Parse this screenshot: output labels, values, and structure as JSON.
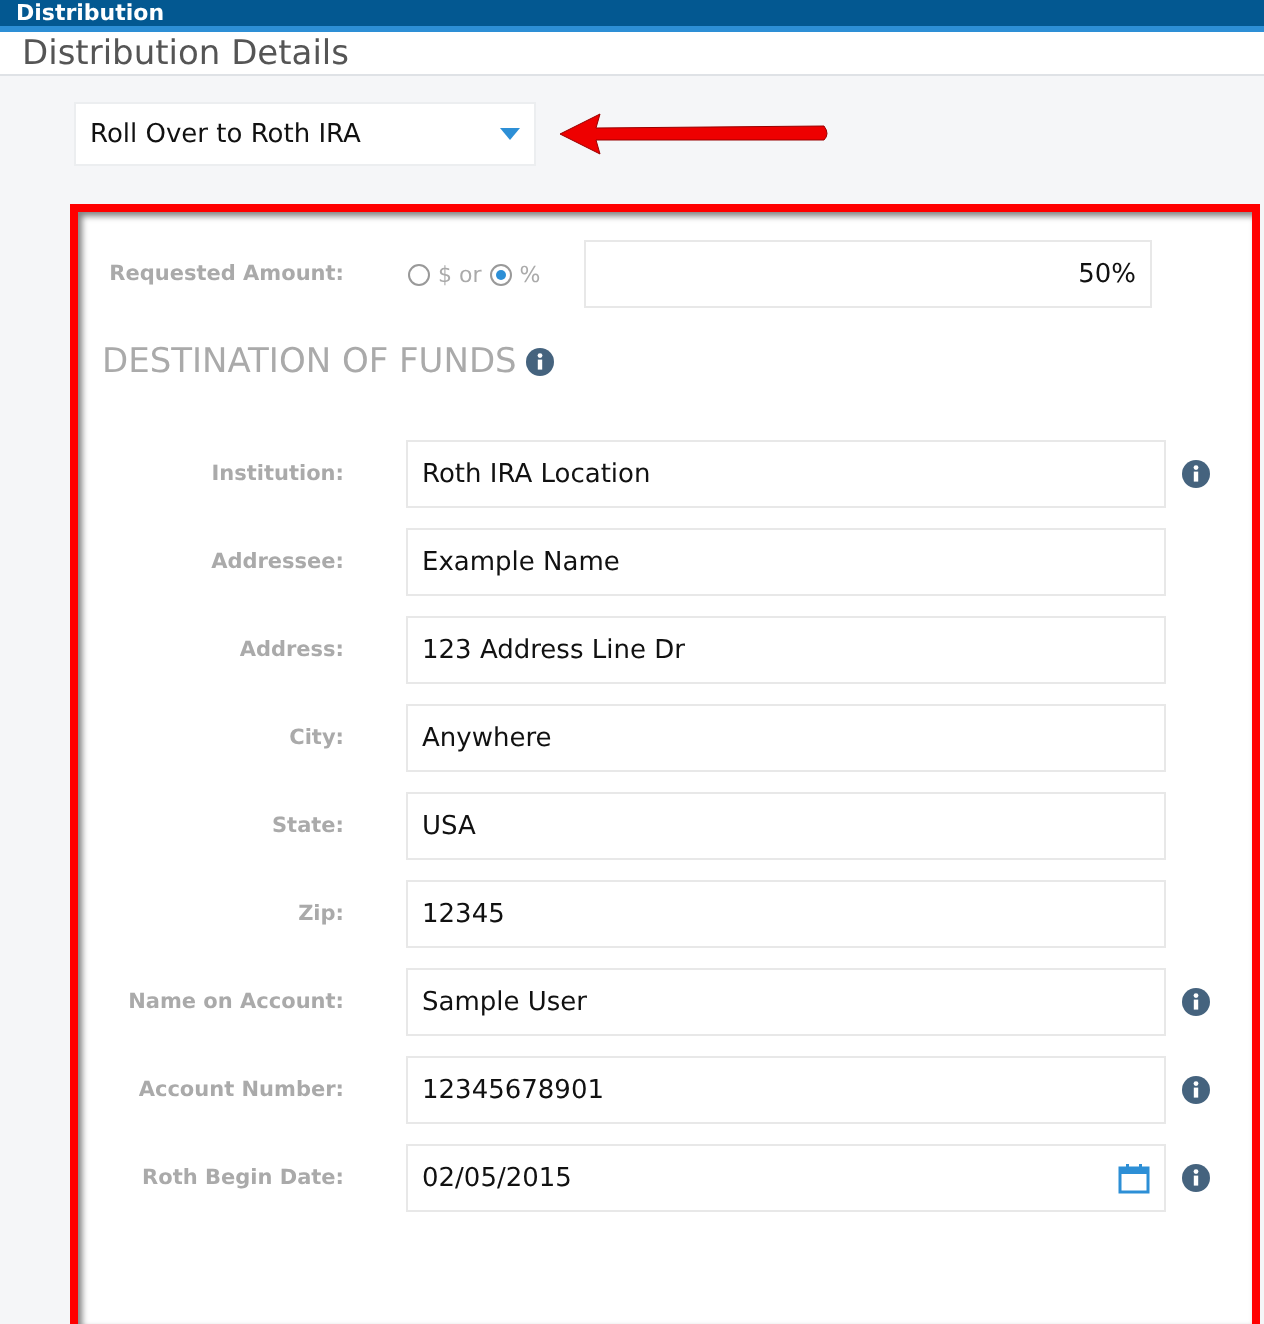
{
  "header": {
    "title": "Distribution"
  },
  "section": {
    "title": "Distribution Details"
  },
  "distribution_type": {
    "value": "Roll Over to Roth IRA"
  },
  "requested_amount": {
    "label": "Requested Amount:",
    "options": [
      {
        "label": "$ or",
        "selected": false
      },
      {
        "label": "%",
        "selected": true
      }
    ],
    "value": "50%"
  },
  "destination": {
    "title": "DESTINATION OF FUNDS",
    "info": true
  },
  "fields": [
    {
      "label": "Institution:",
      "value": "Roth IRA Location",
      "kind": "text",
      "info": true
    },
    {
      "label": "Addressee:",
      "value": "Example Name",
      "kind": "text",
      "info": false
    },
    {
      "label": "Address:",
      "value": "123 Address Line Dr",
      "kind": "text",
      "info": false
    },
    {
      "label": "City:",
      "value": "Anywhere",
      "kind": "text",
      "info": false
    },
    {
      "label": "State:",
      "value": "USA",
      "kind": "text",
      "info": false
    },
    {
      "label": "Zip:",
      "value": "12345",
      "kind": "text",
      "info": false
    },
    {
      "label": "Name on Account:",
      "value": "Sample User",
      "kind": "text",
      "info": true
    },
    {
      "label": "Account Number:",
      "value": "12345678901",
      "kind": "text",
      "info": true
    },
    {
      "label": "Roth Begin Date:",
      "value": "02/05/2015",
      "kind": "date",
      "info": true
    }
  ]
}
